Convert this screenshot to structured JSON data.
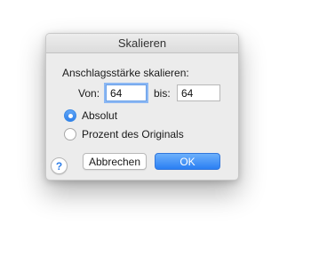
{
  "dialog": {
    "title": "Skalieren",
    "section_label": "Anschlagsstärke skalieren:",
    "from_label": "Von:",
    "from_value": "64",
    "to_label": "bis:",
    "to_value": "64",
    "options": [
      {
        "label": "Absolut",
        "selected": true
      },
      {
        "label": "Prozent des Originals",
        "selected": false
      }
    ],
    "help_icon": "question-mark-icon",
    "help_glyph": "?",
    "cancel_label": "Abbrechen",
    "ok_label": "OK"
  },
  "colors": {
    "accent": "#2f7fe9",
    "dialog_bg": "#ececec"
  }
}
